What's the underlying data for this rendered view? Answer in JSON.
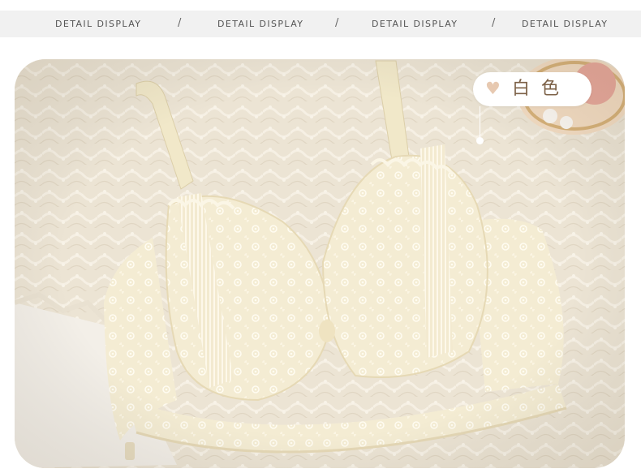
{
  "banner": {
    "items": [
      "DETAIL DISPLAY",
      "DETAIL DISPLAY",
      "DETAIL DISPLAY",
      "DETAIL DISPLAY"
    ],
    "separator": "/"
  },
  "photo": {
    "subject": "cream lace underwire bra with ruffled trim lying on cream knit blanket",
    "accent_colors": {
      "background_fabric": "#ede5d6",
      "bra_lace": "#f7f1dd",
      "shadow": "#d8cdb8"
    }
  },
  "color_tag": {
    "icon": "heart-icon",
    "label": "白色",
    "background": "#ffffff",
    "text_color": "#7c6147",
    "icon_color": "#e7c9b1"
  }
}
